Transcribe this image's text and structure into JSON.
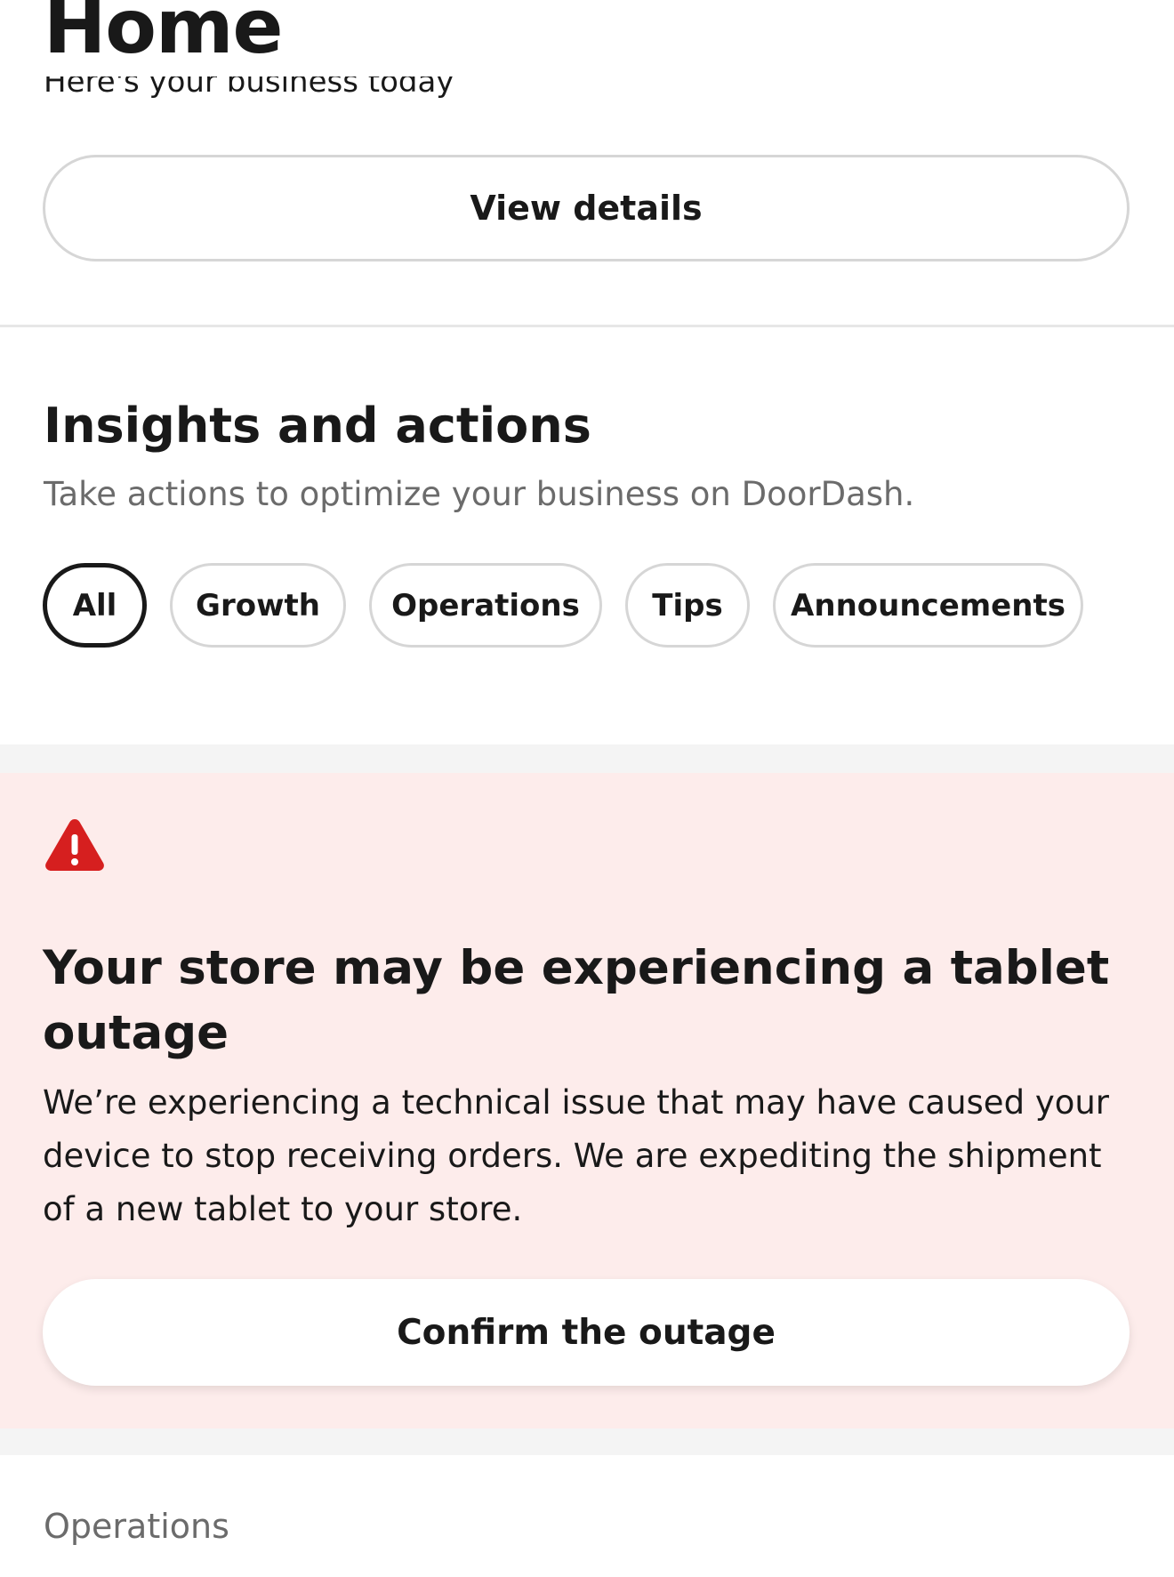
{
  "header": {
    "title": "Home",
    "subtitle_clipped": "Here's your business today"
  },
  "top_card": {
    "view_details_label": "View details"
  },
  "insights": {
    "title": "Insights and actions",
    "description": "Take actions to optimize your business on DoorDash.",
    "filters": [
      {
        "label": "All",
        "selected": true
      },
      {
        "label": "Growth",
        "selected": false
      },
      {
        "label": "Operations",
        "selected": false
      },
      {
        "label": "Tips",
        "selected": false
      },
      {
        "label": "Announcements",
        "selected": false
      }
    ]
  },
  "alert": {
    "icon": "warning-icon",
    "color": "#d61f1f",
    "background": "#fdeceb",
    "title": "Your store may be experiencing a tablet outage",
    "body": "We’re experiencing a technical issue that may have caused your device to stop receiving orders. We are expediting the shipment of a new tablet to your store.",
    "button_label": "Confirm the outage"
  },
  "next_section": {
    "label": "Operations"
  }
}
